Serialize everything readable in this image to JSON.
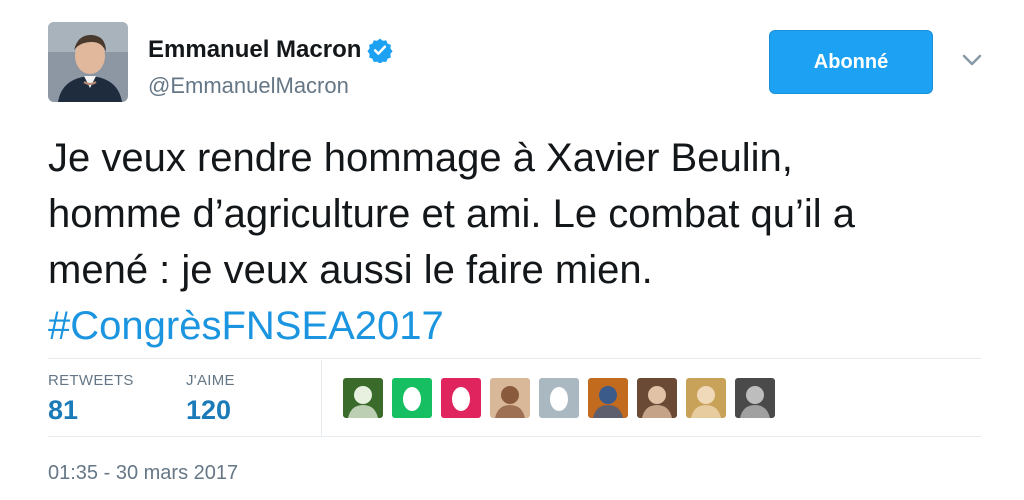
{
  "user": {
    "name": "Emmanuel Macron",
    "handle": "@EmmanuelMacron"
  },
  "follow_button": {
    "label": "Abonné"
  },
  "tweet": {
    "lines": [
      "Je veux rendre hommage à Xavier Beulin,",
      "homme d’agriculture et ami. Le combat qu’il a",
      "mené : je veux aussi le faire mien."
    ],
    "hashtag": "#CongrèsFNSEA2017"
  },
  "stats": {
    "retweets_label": "RETWEETS",
    "retweets_value": "81",
    "likes_label": "J'AIME",
    "likes_value": "120"
  },
  "likers": [
    {
      "name": "liker-avatar-flowers",
      "kind": "photo",
      "colors": [
        "#3a6b2a",
        "#e8f0e0"
      ]
    },
    {
      "name": "liker-avatar-default-green",
      "kind": "egg",
      "colors": [
        "#17bf63",
        "#ffffff"
      ]
    },
    {
      "name": "liker-avatar-default-pink",
      "kind": "egg",
      "colors": [
        "#e0245e",
        "#ffffff"
      ]
    },
    {
      "name": "liker-avatar-woman-glasses",
      "kind": "photo",
      "colors": [
        "#d9b89a",
        "#8a5a3c"
      ]
    },
    {
      "name": "liker-avatar-default-gray",
      "kind": "egg",
      "colors": [
        "#aab8c2",
        "#ffffff"
      ]
    },
    {
      "name": "liker-avatar-painting",
      "kind": "photo",
      "colors": [
        "#c26a1e",
        "#3b5b8a"
      ]
    },
    {
      "name": "liker-avatar-woman-dark-hair",
      "kind": "photo",
      "colors": [
        "#6b4a35",
        "#e2c2a6"
      ]
    },
    {
      "name": "liker-avatar-woman-blonde",
      "kind": "photo",
      "colors": [
        "#c9a25a",
        "#f0d9b8"
      ]
    },
    {
      "name": "liker-avatar-bw-photo",
      "kind": "photo",
      "colors": [
        "#4a4a4a",
        "#bdbdbd"
      ]
    }
  ],
  "timestamp": "01:35 - 30 mars 2017",
  "colors": {
    "accent": "#1da1f2",
    "link": "#1b95e0",
    "stat_value": "#1b7ab8",
    "muted": "#657786",
    "text": "#14171a"
  },
  "icons": {
    "verified": "verified-badge-icon",
    "caret": "chevron-down-icon"
  }
}
